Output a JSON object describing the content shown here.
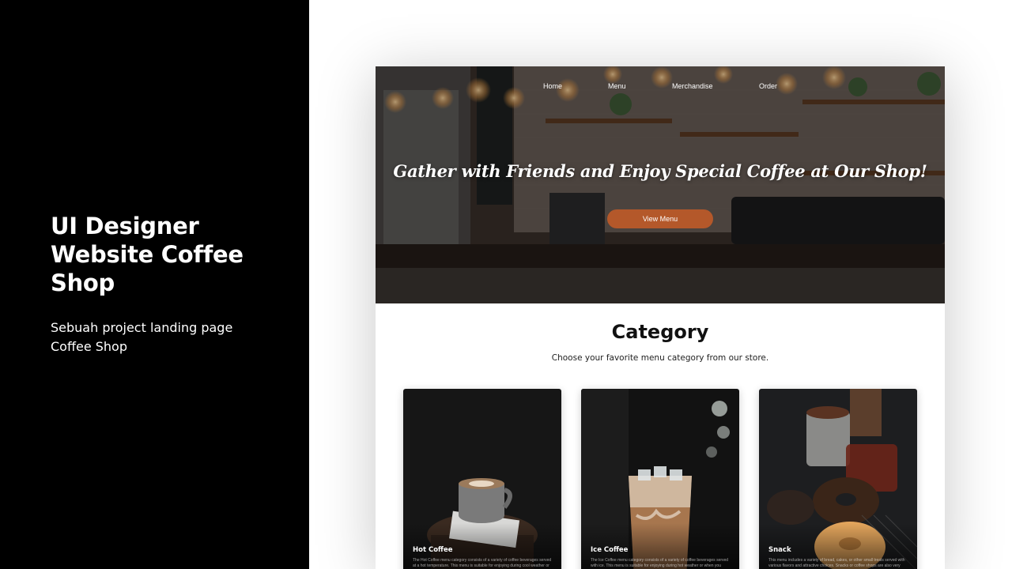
{
  "left": {
    "title": "UI Designer Website Coffee Shop",
    "subtitle": "Sebuah project landing page Coffee Shop"
  },
  "mockup": {
    "nav": [
      {
        "label": "Home"
      },
      {
        "label": "Menu"
      },
      {
        "label": "Merchandise"
      },
      {
        "label": "Order"
      }
    ],
    "hero": {
      "title": "Gather with Friends and Enjoy Special Coffee at Our Shop!",
      "button_label": "View Menu",
      "button_color": "#b4582a"
    },
    "category": {
      "title": "Category",
      "subtitle": "Choose your favorite menu category from our store.",
      "cards": [
        {
          "name": "Hot Coffee",
          "description": "The Hot Coffee menu category consists of a variety of coffee beverages served at a hot temperature. This menu is suitable for enjoying during cool weather or"
        },
        {
          "name": "Ice Coffee",
          "description": "The Ice Coffee menu category consists of a variety of coffee beverages served with ice. This menu is suitable for enjoying during hot weather or when you"
        },
        {
          "name": "Snack",
          "description": "This menu includes a variety of bread, cakes, or other small treats served with various flavors and attractive choices. Snacks or coffee shops are also very"
        }
      ]
    }
  }
}
